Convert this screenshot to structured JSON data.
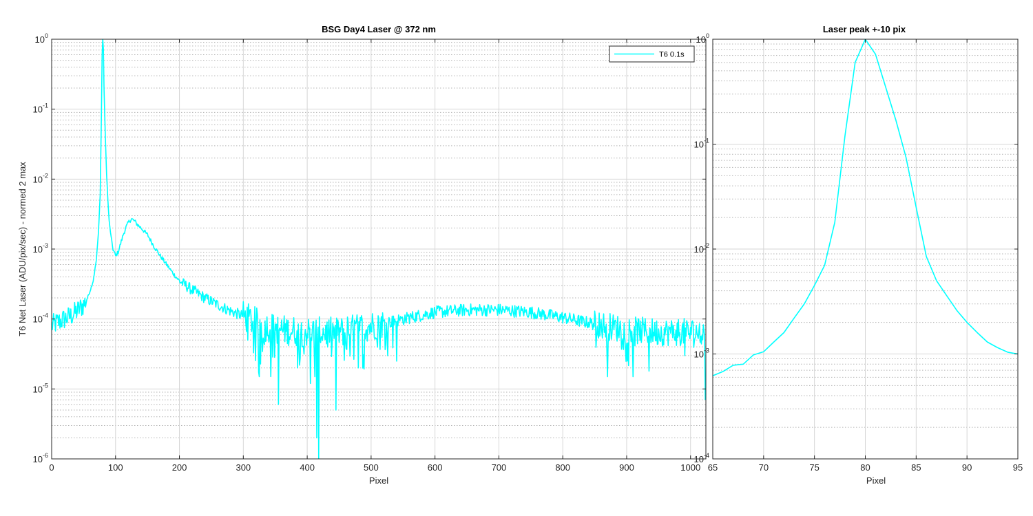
{
  "chart_data": [
    {
      "type": "line",
      "title": "BSG  Day4 Laser @ 372 nm",
      "xlabel": "Pixel",
      "ylabel": "T6 Net Laser (ADU/pix/sec) - normed 2 max",
      "xlim": [
        0,
        1024
      ],
      "ylim": [
        1e-06,
        1
      ],
      "yscale": "log",
      "xticks": [
        0,
        100,
        200,
        300,
        400,
        500,
        600,
        700,
        800,
        900,
        1000
      ],
      "yticks": [
        1e-06,
        1e-05,
        0.0001,
        0.001,
        0.01,
        0.1,
        1
      ],
      "ytick_labels": [
        [
          "10",
          "-6"
        ],
        [
          "10",
          "-5"
        ],
        [
          "10",
          "-4"
        ],
        [
          "10",
          "-3"
        ],
        [
          "10",
          "-2"
        ],
        [
          "10",
          "-1"
        ],
        [
          "10",
          "0"
        ]
      ],
      "grid": true,
      "minor_grid": true,
      "legend": {
        "placement": "top-right",
        "entries": [
          "T6 0.1s"
        ]
      },
      "series": [
        {
          "name": "T6 0.1s",
          "color": "#00ffff",
          "anchors_x": [
            0,
            10,
            20,
            30,
            40,
            50,
            55,
            60,
            65,
            70,
            73,
            76,
            78,
            79,
            80,
            81,
            82,
            84,
            86,
            88,
            90,
            93,
            96,
            100,
            104,
            108,
            112,
            116,
            120,
            125,
            130,
            135,
            140,
            150,
            160,
            170,
            180,
            190,
            200,
            220,
            240,
            260,
            280,
            300,
            330,
            360,
            400,
            450,
            500,
            550,
            600,
            650,
            700,
            750,
            800,
            850,
            900,
            950,
            1000,
            1024
          ],
          "anchors_y": [
            8e-05,
            9e-05,
            0.0001,
            0.00011,
            0.00013,
            0.00016,
            0.00019,
            0.00025,
            0.00035,
            0.0007,
            0.0016,
            0.006,
            0.1,
            0.6,
            1.0,
            0.7,
            0.2,
            0.04,
            0.012,
            0.005,
            0.0025,
            0.0015,
            0.001,
            0.0008,
            0.0009,
            0.0012,
            0.0016,
            0.002,
            0.0024,
            0.0027,
            0.0025,
            0.0022,
            0.002,
            0.0016,
            0.0011,
            0.0008,
            0.0006,
            0.00045,
            0.00035,
            0.00026,
            0.0002,
            0.00016,
            0.00013,
            0.00011,
            8e-05,
            7e-05,
            6.5e-05,
            6.5e-05,
            8e-05,
            0.0001,
            0.000125,
            0.000135,
            0.000135,
            0.000125,
            0.000105,
            8.5e-05,
            7e-05,
            6.5e-05,
            6.5e-05,
            6.5e-05
          ],
          "dips": [
            [
              325,
              1.5e-05
            ],
            [
              355,
              6e-06
            ],
            [
              385,
              2e-05
            ],
            [
              405,
              1.2e-05
            ],
            [
              412,
              1.5e-05
            ],
            [
              415,
              2e-06
            ],
            [
              418,
              1e-06
            ],
            [
              445,
              5e-06
            ],
            [
              480,
              2e-05
            ],
            [
              540,
              2.5e-05
            ],
            [
              870,
              1.5e-05
            ],
            [
              910,
              1.5e-05
            ],
            [
              935,
              1.8e-05
            ],
            [
              1023,
              7e-06
            ]
          ]
        }
      ]
    },
    {
      "type": "line",
      "title": "Laser peak +-10 pix",
      "xlabel": "Pixel",
      "ylabel": "",
      "xlim": [
        65,
        95
      ],
      "ylim": [
        0.0001,
        1
      ],
      "yscale": "log",
      "xticks": [
        65,
        70,
        75,
        80,
        85,
        90,
        95
      ],
      "yticks": [
        0.0001,
        0.001,
        0.01,
        0.1,
        1
      ],
      "ytick_labels": [
        [
          "10",
          "-4"
        ],
        [
          "10",
          "-3"
        ],
        [
          "10",
          "-2"
        ],
        [
          "10",
          "-1"
        ],
        [
          "10",
          "0"
        ]
      ],
      "grid": true,
      "minor_grid": true,
      "series": [
        {
          "color": "#00ffff",
          "x": [
            65,
            66,
            67,
            68,
            69,
            70,
            71,
            72,
            73,
            74,
            75,
            76,
            77,
            78,
            79,
            80,
            81,
            82,
            83,
            84,
            85,
            86,
            87,
            88,
            89,
            90,
            91,
            92,
            93,
            94,
            95
          ],
          "y": [
            0.00062,
            0.00068,
            0.00078,
            0.0008,
            0.00098,
            0.00105,
            0.0013,
            0.0016,
            0.0022,
            0.003,
            0.0045,
            0.007,
            0.018,
            0.12,
            0.6,
            1.0,
            0.72,
            0.35,
            0.17,
            0.075,
            0.025,
            0.0085,
            0.005,
            0.0036,
            0.0026,
            0.002,
            0.0016,
            0.0013,
            0.00115,
            0.00104,
            0.001
          ]
        }
      ]
    }
  ]
}
